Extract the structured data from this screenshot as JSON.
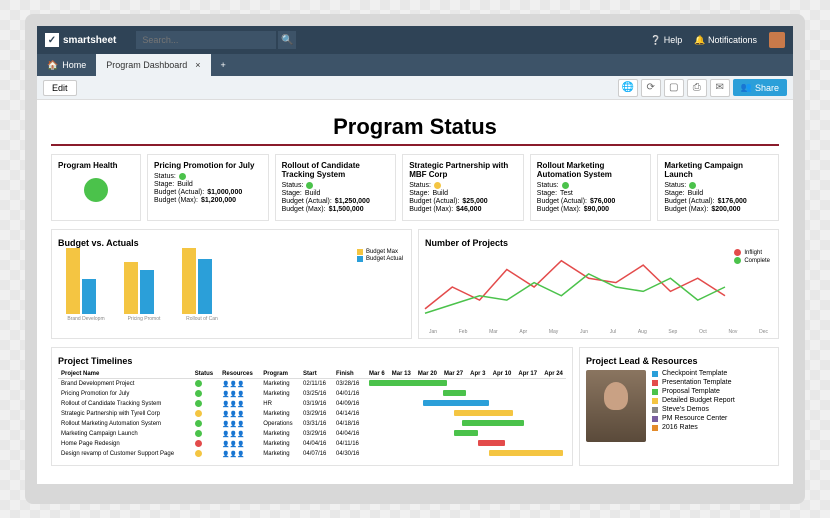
{
  "brand": "smartsheet",
  "search": {
    "placeholder": "Search..."
  },
  "top_links": {
    "help": "Help",
    "notifications": "Notifications"
  },
  "tabs": {
    "home": "Home",
    "dashboard": "Program Dashboard"
  },
  "toolbar": {
    "edit": "Edit",
    "share": "Share"
  },
  "page_title": "Program Status",
  "health": {
    "title": "Program Health",
    "color": "#4bc24b"
  },
  "cards": [
    {
      "title": "Pricing Promotion for July",
      "status": "green",
      "stage": "Build",
      "budget_actual": "$1,000,000",
      "budget_max": "$1,200,000"
    },
    {
      "title": "Rollout of Candidate Tracking System",
      "status": "green",
      "stage": "Build",
      "budget_actual": "$1,250,000",
      "budget_max": "$1,500,000"
    },
    {
      "title": "Strategic Partnership with MBF Corp",
      "status": "yellow",
      "stage": "Build",
      "budget_actual": "$25,000",
      "budget_max": "$46,000"
    },
    {
      "title": "Rollout Marketing Automation System",
      "status": "green",
      "stage": "Test",
      "budget_actual": "$76,000",
      "budget_max": "$90,000"
    },
    {
      "title": "Marketing Campaign Launch",
      "status": "green",
      "stage": "Build",
      "budget_actual": "$176,000",
      "budget_max": "$200,000"
    }
  ],
  "labels": {
    "status": "Status:",
    "stage": "Stage:",
    "ba": "Budget (Actual):",
    "bm": "Budget (Max):"
  },
  "budget_chart": {
    "title": "Budget vs. Actuals",
    "legend": [
      "Budget Max",
      "Budget Actual"
    ]
  },
  "projects_chart": {
    "title": "Number of Projects",
    "legend": [
      "Inflight",
      "Complete"
    ]
  },
  "chart_data": [
    {
      "type": "bar",
      "title": "Budget vs. Actuals",
      "categories": [
        "Brand Development Project",
        "Pricing Promotion for July",
        "Rollout of Candidate Tracking System"
      ],
      "series": [
        {
          "name": "Budget Max",
          "values": [
            1500000,
            1200000,
            1500000
          ],
          "color": "#f4c542"
        },
        {
          "name": "Budget Actual",
          "values": [
            800000,
            1000000,
            1250000
          ],
          "color": "#2b9fd9"
        }
      ],
      "ylim": [
        0,
        1600000
      ]
    },
    {
      "type": "line",
      "title": "Number of Projects",
      "x": [
        "Jan",
        "Feb",
        "Mar",
        "Apr",
        "May",
        "Jun",
        "Jul",
        "Aug",
        "Sep",
        "Oct",
        "Nov",
        "Dec"
      ],
      "series": [
        {
          "name": "Inflight",
          "values": [
            3,
            8,
            5,
            12,
            8,
            14,
            10,
            9,
            13,
            7,
            10,
            6
          ],
          "color": "#e34b4b"
        },
        {
          "name": "Complete",
          "values": [
            2,
            4,
            6,
            5,
            9,
            6,
            11,
            8,
            7,
            10,
            5,
            8
          ],
          "color": "#4bc24b"
        }
      ],
      "ylim": [
        0,
        16
      ]
    }
  ],
  "timelines": {
    "title": "Project Timelines",
    "cols": [
      "Project Name",
      "Status",
      "Resources",
      "Program",
      "Start",
      "Finish"
    ],
    "months": [
      "Mar 6",
      "Mar 13",
      "Mar 20",
      "Mar 27",
      "Apr 3",
      "Apr 10",
      "Apr 17",
      "Apr 24"
    ],
    "rows": [
      {
        "name": "Brand Development Project",
        "status": "green",
        "program": "Marketing",
        "start": "02/11/16",
        "finish": "03/28/16",
        "g": {
          "l": 0,
          "w": 40,
          "c": "#4bc24b"
        }
      },
      {
        "name": "Pricing Promotion for July",
        "status": "green",
        "program": "Marketing",
        "start": "03/25/16",
        "finish": "04/01/16",
        "g": {
          "l": 38,
          "w": 12,
          "c": "#4bc24b"
        }
      },
      {
        "name": "Rollout of Candidate Tracking System",
        "status": "green",
        "program": "HR",
        "start": "03/19/16",
        "finish": "04/09/16",
        "g": {
          "l": 28,
          "w": 34,
          "c": "#2b9fd9"
        }
      },
      {
        "name": "Strategic Partnership with Tyrell Corp",
        "status": "yellow",
        "program": "Marketing",
        "start": "03/29/16",
        "finish": "04/14/16",
        "g": {
          "l": 44,
          "w": 30,
          "c": "#f4c542"
        }
      },
      {
        "name": "Rollout Marketing Automation System",
        "status": "green",
        "program": "Operations",
        "start": "03/31/16",
        "finish": "04/18/16",
        "g": {
          "l": 48,
          "w": 32,
          "c": "#4bc24b"
        }
      },
      {
        "name": "Marketing Campaign Launch",
        "status": "green",
        "program": "Marketing",
        "start": "03/29/16",
        "finish": "04/04/16",
        "g": {
          "l": 44,
          "w": 12,
          "c": "#4bc24b"
        }
      },
      {
        "name": "Home Page Redesign",
        "status": "red",
        "program": "Marketing",
        "start": "04/04/16",
        "finish": "04/11/16",
        "g": {
          "l": 56,
          "w": 14,
          "c": "#e34b4b"
        }
      },
      {
        "name": "Design revamp of Customer Support Page",
        "status": "yellow",
        "program": "Marketing",
        "start": "04/07/16",
        "finish": "04/30/16",
        "g": {
          "l": 62,
          "w": 38,
          "c": "#f4c542"
        }
      }
    ]
  },
  "lead": {
    "title": "Project Lead & Resources",
    "items": [
      {
        "c": "#2b9fd9",
        "t": "Checkpoint Template"
      },
      {
        "c": "#e34b4b",
        "t": "Presentation Template"
      },
      {
        "c": "#4bc24b",
        "t": "Proposal Template"
      },
      {
        "c": "#f4c542",
        "t": "Detailed Budget Report"
      },
      {
        "c": "#888",
        "t": "Steve's Demos"
      },
      {
        "c": "#7a5fa0",
        "t": "PM Resource Center"
      },
      {
        "c": "#e38b2b",
        "t": "2016 Rates"
      }
    ]
  }
}
